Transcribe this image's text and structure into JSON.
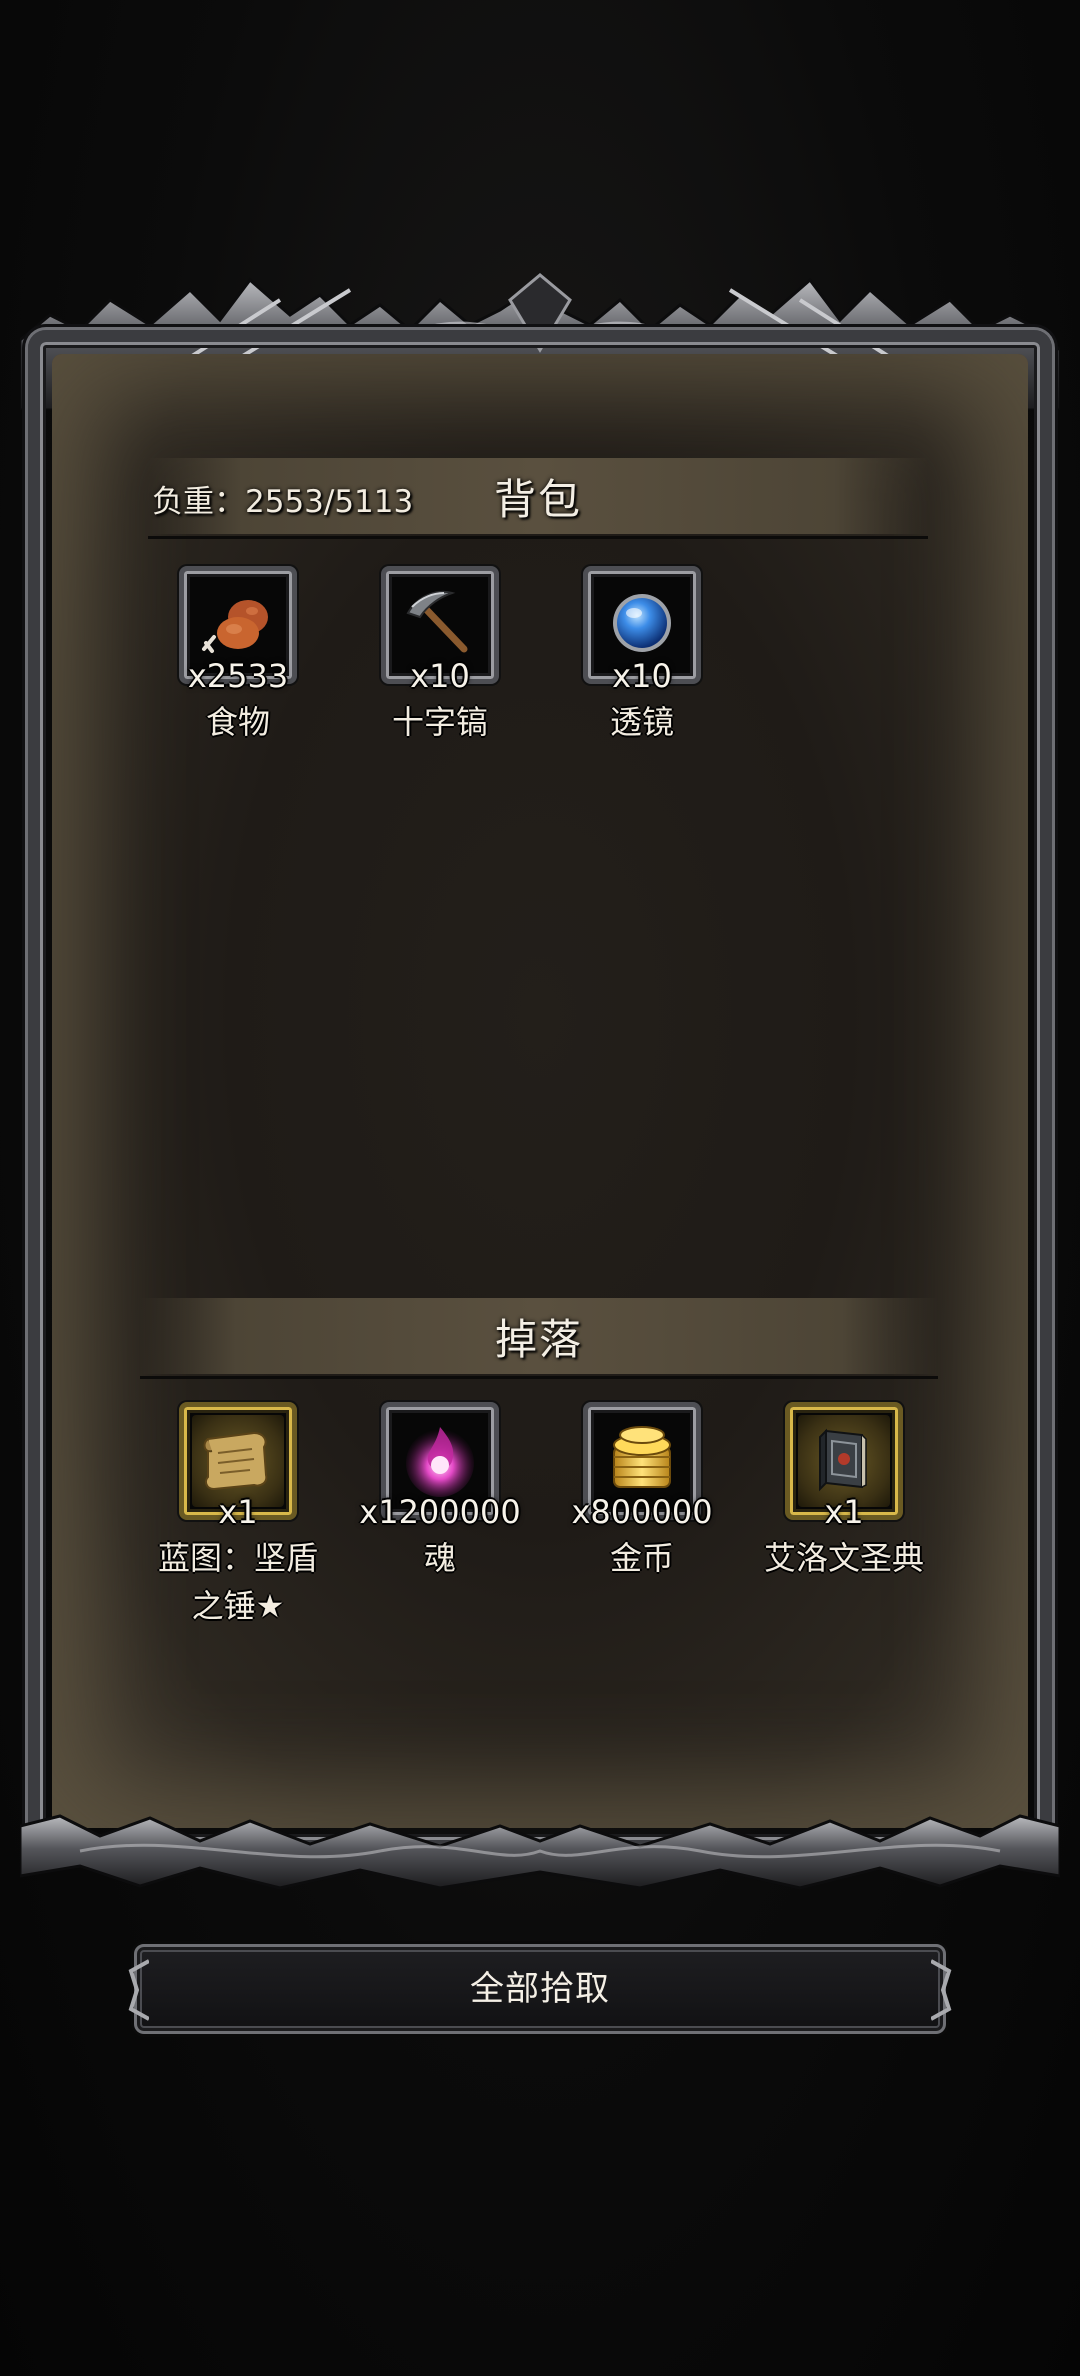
{
  "backpack": {
    "title": "背包",
    "weight_label": "负重：2553/5113",
    "items": [
      {
        "name": "食物",
        "qty": "x2533",
        "icon": "roast-meat-icon"
      },
      {
        "name": "十字镐",
        "qty": "x10",
        "icon": "pickaxe-icon"
      },
      {
        "name": "透镜",
        "qty": "x10",
        "icon": "blue-lens-orb-icon"
      }
    ]
  },
  "drops": {
    "title": "掉落",
    "items": [
      {
        "name_line1": "蓝图：坚盾",
        "name_line2": "之锤★",
        "qty": "x1",
        "icon": "blueprint-scroll-icon",
        "rarity_color": "#d8b84a"
      },
      {
        "name_line1": "魂",
        "qty": "x1200000",
        "icon": "soul-flame-icon"
      },
      {
        "name_line1": "金币",
        "qty": "x800000",
        "icon": "gold-coin-stack-icon"
      },
      {
        "name_line1": "艾洛文圣典",
        "qty": "x1",
        "icon": "tome-book-icon",
        "rarity_color": "#d8b84a"
      }
    ]
  },
  "actions": {
    "collect_all": "全部拾取"
  },
  "colors": {
    "frame_metal": "#6e6f74",
    "parchment_dark": "#1f1b17",
    "section_bar": "#5a503f"
  }
}
